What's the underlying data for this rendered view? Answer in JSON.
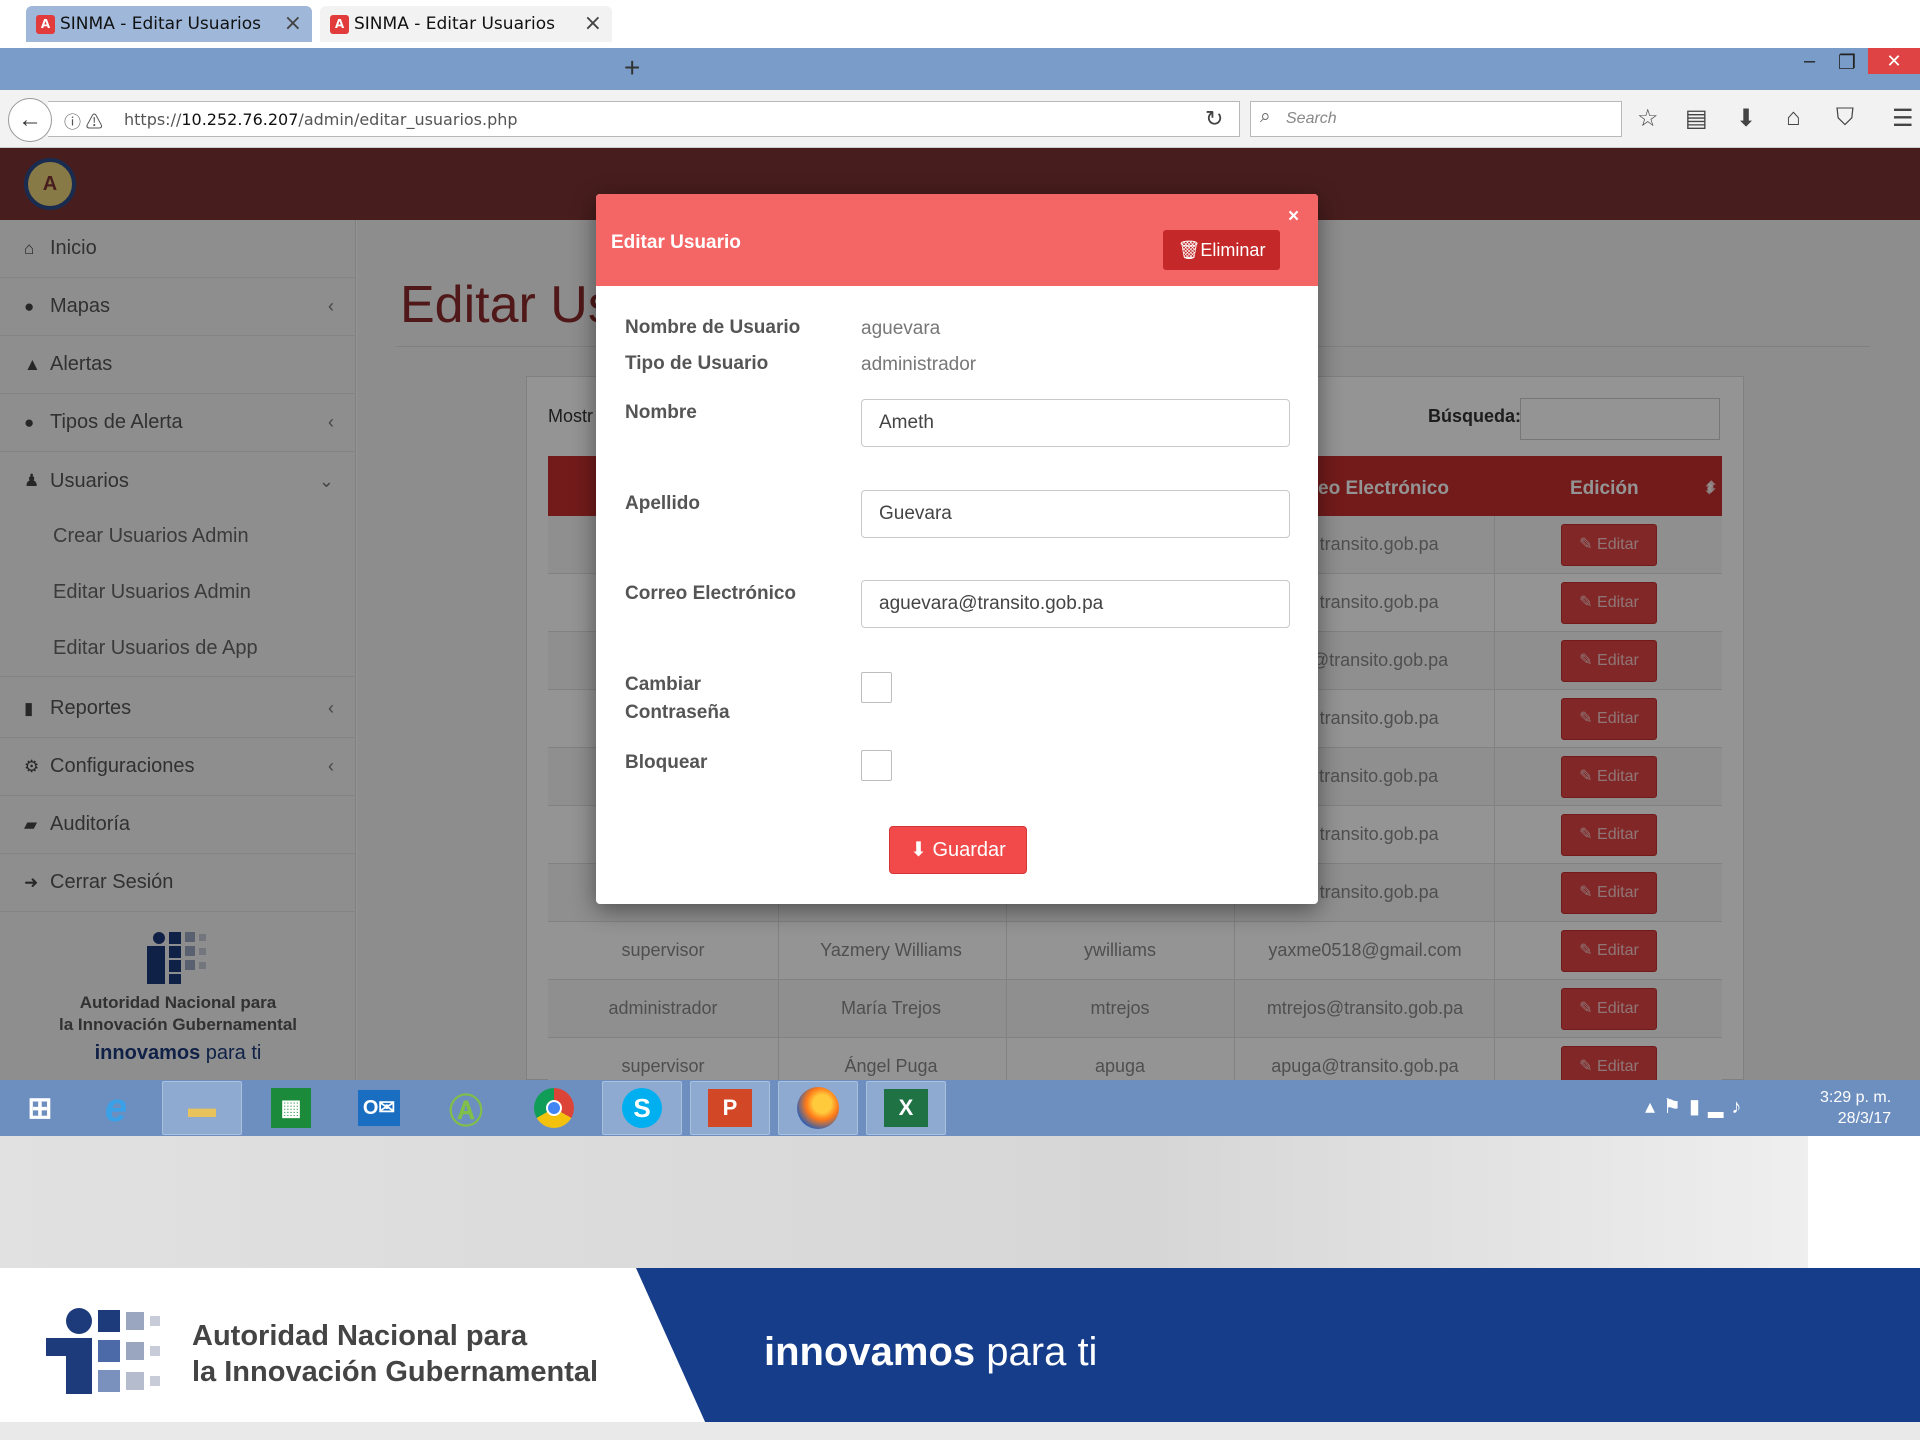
{
  "browser": {
    "tabs": [
      {
        "title": "SINMA - Editar Usuarios",
        "active": false
      },
      {
        "title": "SINMA - Editar Usuarios",
        "active": true
      }
    ],
    "url_prefix": "https://",
    "url_host": "10.252.76.207",
    "url_path": "/admin/editar_usuarios.php",
    "search_placeholder": "Search"
  },
  "sidebar": {
    "items": [
      {
        "label": "Inicio",
        "icon": "home-icon"
      },
      {
        "label": "Mapas",
        "icon": "globe-icon"
      },
      {
        "label": "Alertas",
        "icon": "warning-icon"
      },
      {
        "label": "Tipos de Alerta",
        "icon": "exclamation-circle-icon"
      },
      {
        "label": "Usuarios",
        "icon": "users-icon"
      },
      {
        "label": "Reportes",
        "icon": "file-icon"
      },
      {
        "label": "Configuraciones",
        "icon": "gears-icon"
      },
      {
        "label": "Auditoría",
        "icon": "book-icon"
      },
      {
        "label": "Cerrar Sesión",
        "icon": "sign-out-icon"
      }
    ],
    "sub_items": [
      "Crear Usuarios Admin",
      "Editar Usuarios Admin",
      "Editar Usuarios de App"
    ],
    "logo_line1": "Autoridad Nacional para",
    "logo_line2": "la Innovación Gubernamental",
    "logo_slogan_bold": "innovamos",
    "logo_slogan_rest": " para ti"
  },
  "main": {
    "title": "Editar Us",
    "show_label": "Mostr",
    "search_label": "Búsqueda:",
    "headers": {
      "email": "eo Electrónico",
      "edit": "Edición"
    },
    "edit_label": "Editar",
    "rows": [
      {
        "tipo": "",
        "nombre": "",
        "usuario": "",
        "correo": "a@transito.gob.pa"
      },
      {
        "tipo": "",
        "nombre": "",
        "usuario": "",
        "correo": "a@transito.gob.pa"
      },
      {
        "tipo": "",
        "nombre": "",
        "usuario": "",
        "correo": "uez@transito.gob.pa"
      },
      {
        "tipo": "",
        "nombre": "",
        "usuario": "",
        "correo": "a@transito.gob.pa"
      },
      {
        "tipo": "",
        "nombre": "",
        "usuario": "",
        "correo": "z@transito.gob.pa"
      },
      {
        "tipo": "",
        "nombre": "",
        "usuario": "",
        "correo": "a@transito.gob.pa"
      },
      {
        "tipo": "",
        "nombre": "",
        "usuario": "",
        "correo": "o@transito.gob.pa"
      },
      {
        "tipo": "supervisor",
        "nombre": "Yazmery Williams",
        "usuario": "ywilliams",
        "correo": "yaxme0518@gmail.com"
      },
      {
        "tipo": "administrador",
        "nombre": "María Trejos",
        "usuario": "mtrejos",
        "correo": "mtrejos@transito.gob.pa"
      },
      {
        "tipo": "supervisor",
        "nombre": "Ángel Puga",
        "usuario": "apuga",
        "correo": "apuga@transito.gob.pa"
      }
    ]
  },
  "modal": {
    "title": "Editar Usuario",
    "delete_label": "Eliminar",
    "close_glyph": "×",
    "username_label": "Nombre de Usuario",
    "username_value": "aguevara",
    "type_label": "Tipo de Usuario",
    "type_value": "administrador",
    "name_label": "Nombre",
    "name_value": "Ameth",
    "lastname_label": "Apellido",
    "lastname_value": "Guevara",
    "email_label": "Correo Electrónico",
    "email_value": "aguevara@transito.gob.pa",
    "change_password_label_1": "Cambiar",
    "change_password_label_2": "Contraseña",
    "change_password_checked": false,
    "block_label": "Bloquear",
    "block_checked": false,
    "save_label": "Guardar"
  },
  "taskbar": {
    "time": "3:29 p. m.",
    "date": "28/3/17",
    "apps": [
      "windows-start-icon",
      "internet-explorer-icon",
      "file-explorer-icon",
      "store-icon",
      "outlook-icon",
      "android-studio-icon",
      "chrome-icon",
      "skype-icon",
      "powerpoint-icon",
      "firefox-icon",
      "excel-icon"
    ]
  },
  "footer": {
    "line1": "Autoridad Nacional para",
    "line2": "la Innovación Gubernamental",
    "slogan_bold": "innovamos",
    "slogan_rest": " para ti"
  },
  "colors": {
    "app_header": "#7c3232",
    "modal_header": "#f46666",
    "table_header": "#c62f2f",
    "footer_blue": "#153d8a"
  }
}
